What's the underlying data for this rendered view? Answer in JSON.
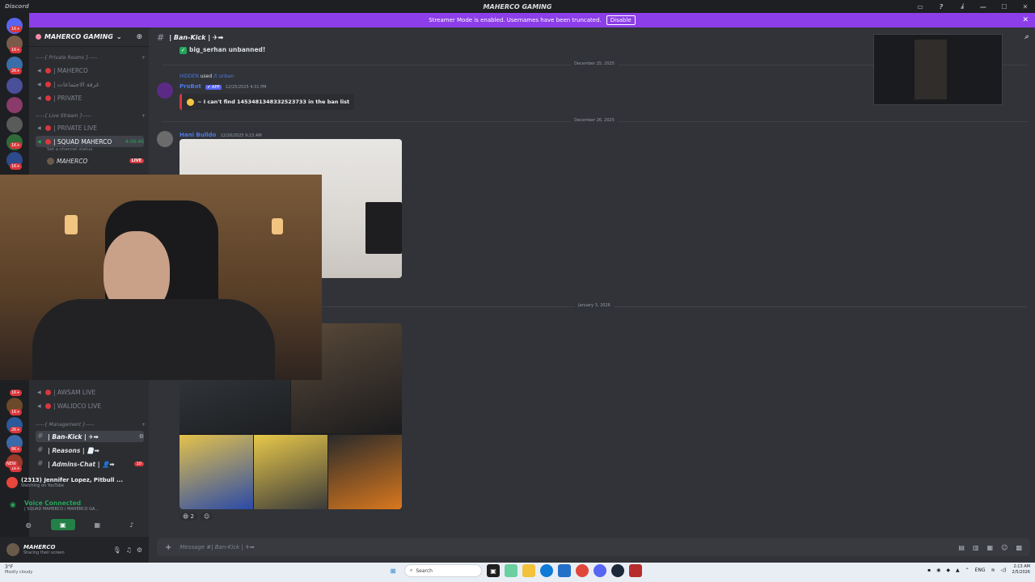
{
  "window": {
    "title": "MAHERCO GAMING",
    "left_label": "Discord"
  },
  "banner": {
    "text": "Streamer Mode is enabled. Usernames have been truncated.",
    "button": "Disable"
  },
  "server_rail": {
    "badges": [
      "1K+",
      "1K+",
      "2K+",
      "1K+",
      "1K+",
      "1K+",
      "1K+",
      "2K+",
      "8K+",
      "1K+",
      "NEW"
    ]
  },
  "sidebar": {
    "server_name": "MAHERCO GAMING",
    "categories": {
      "private": "-----{ Private Rooms }-----",
      "live": "-----{ Live Stream }-----",
      "management": "-----{ Management }-----"
    },
    "channels": {
      "c1": "| MAHERCO",
      "c2": "| غرفة الاجتماعات",
      "c3": "| PRIVATE",
      "c4": "| PRIVATE LIVE",
      "c5": "| SQUAD MAHERCO",
      "c5_time": "4:06:46",
      "c5_status": "Set a channel status",
      "member1": "MAHERCO",
      "member1_live": "LIVE",
      "c6": "| AWSAM LIVE",
      "c7": "| WALIDCO LIVE",
      "t1": "| Ban-Kick | ✈➡",
      "t2": "| Reasons | 📄➡",
      "t3": "| Admins-Chat | 👤➡",
      "t3_badge": "10"
    },
    "now_playing": {
      "title": "(2313) Jennifer Lopez, Pitbull ...",
      "sub": "Watching on YouTube"
    },
    "voice": {
      "title": "Voice Connected",
      "sub": "| SQUAD MAHERCO / MAHERCO GA..."
    },
    "user": {
      "name": "MAHERCO",
      "status": "Sharing their screen"
    }
  },
  "chat": {
    "channel_title": "| Ban-Kick | ✈➡",
    "msg_unban": "big_serhan unbanned!",
    "date1": "December 25, 2025",
    "cmd_user": "HIDDEN",
    "cmd_used": "used",
    "cmd_name": "/t unban",
    "bot_name": "ProBot",
    "bot_tag": "✔ APP",
    "bot_ts": "12/25/2025 4:31 PM",
    "bot_reply": "~ I can't find 1453481348332523733 in the ban list",
    "date2": "December 26, 2025",
    "msg2_author": "Hani Bulldo",
    "msg2_ts": "12/26/2025 9:23 AM",
    "date3": "January 3, 2026",
    "reaction_count": "2",
    "composer_placeholder": "Message #| Ban-Kick | ✈➡"
  },
  "taskbar": {
    "weather_temp": "3°F",
    "weather_desc": "Mostly cloudy",
    "search_placeholder": "Search",
    "lang": "ENG",
    "time": "2:13 AM",
    "date": "2/5/2026"
  }
}
